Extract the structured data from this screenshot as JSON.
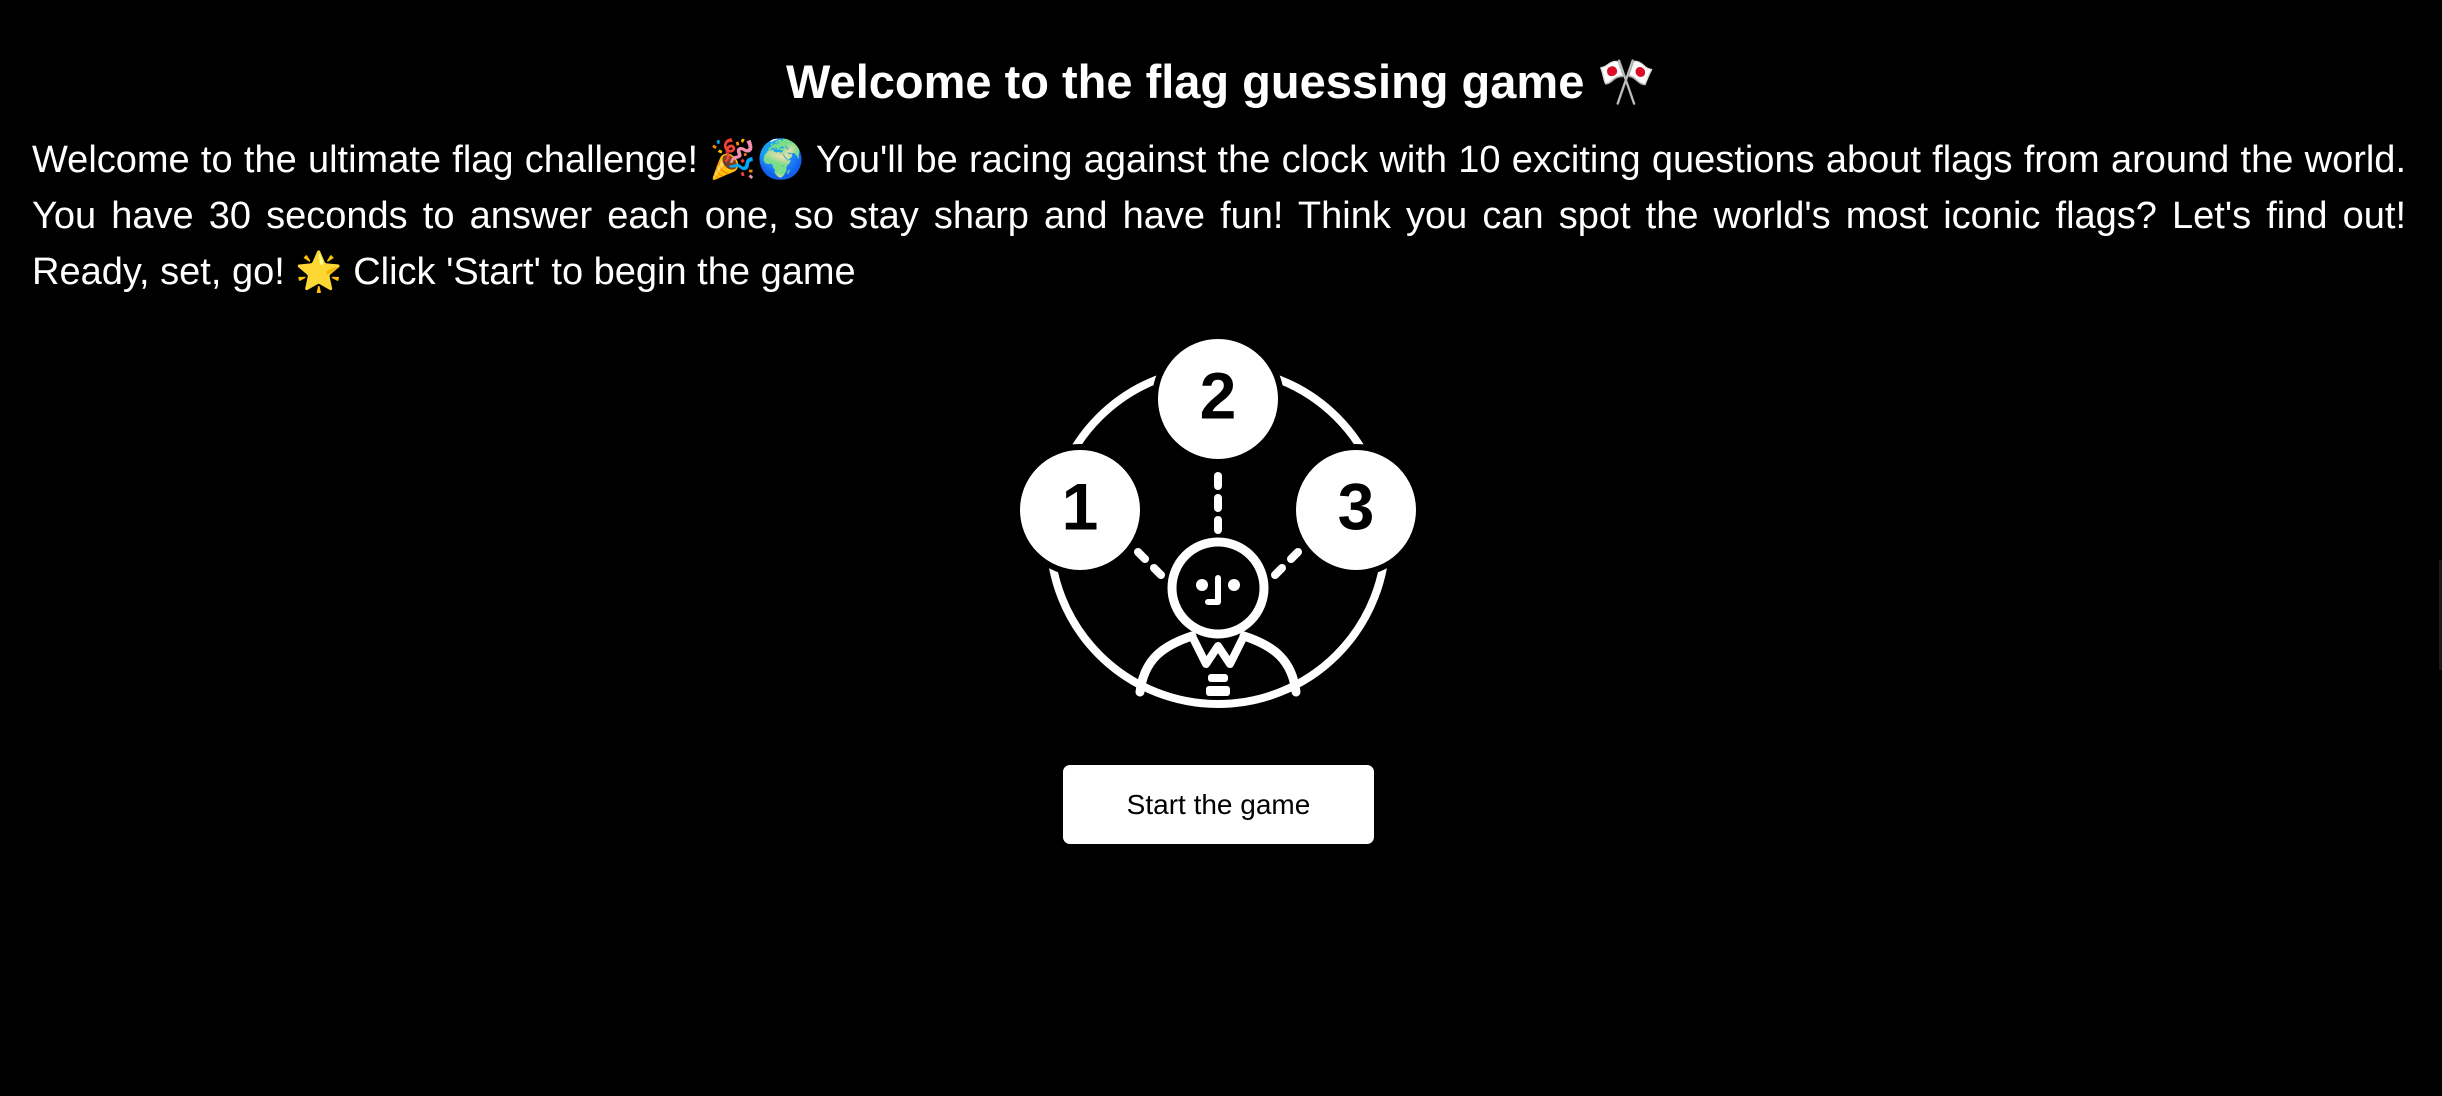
{
  "header": {
    "title": "Welcome to the flag guessing game",
    "title_emoji": "🎌"
  },
  "intro": {
    "text": "Welcome to the ultimate flag challenge! 🎉🌍 You'll be racing against the clock with 10 exciting questions about flags from around the world. You have 30 seconds to answer each one, so stay sharp and have fun! Think you can spot the world's most iconic flags? Let's find out! Ready, set, go! 🌟 Click 'Start' to begin the game"
  },
  "illustration": {
    "icon": "quiz-choice-icon",
    "options": [
      "1",
      "2",
      "3"
    ]
  },
  "actions": {
    "start_label": "Start the game"
  },
  "colors": {
    "background": "#000000",
    "foreground": "#ffffff",
    "button_background": "#ffffff",
    "button_text": "#000000"
  }
}
